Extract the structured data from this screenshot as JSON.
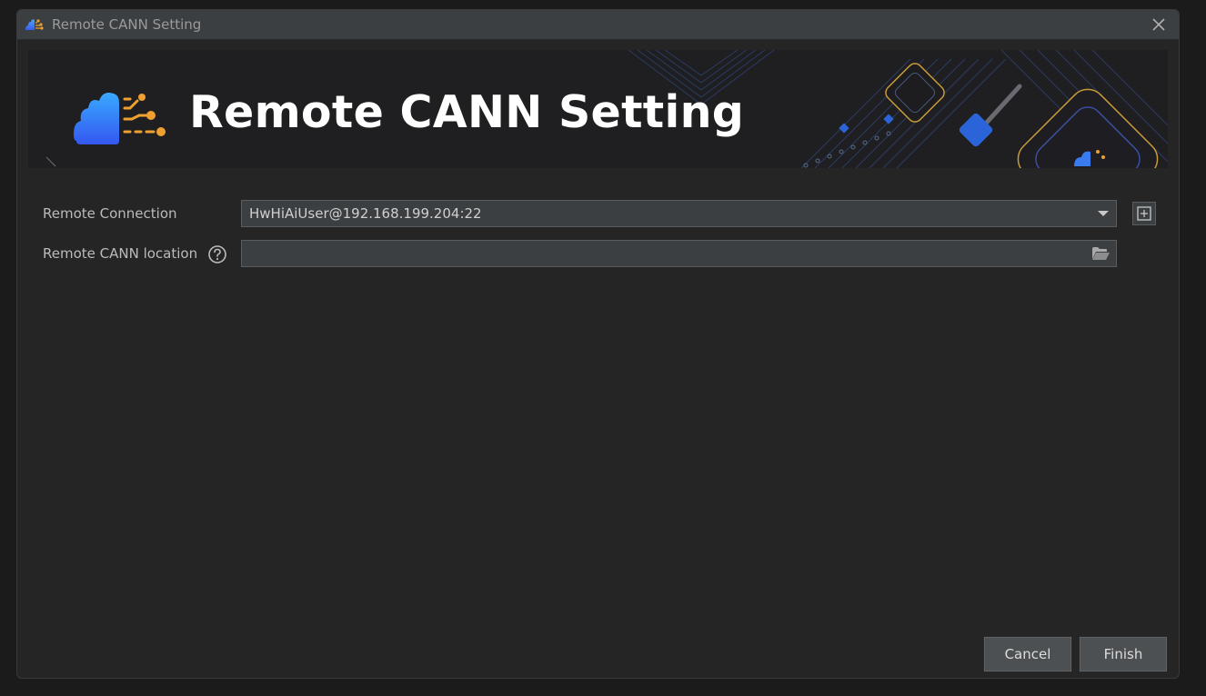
{
  "window": {
    "title": "Remote CANN Setting"
  },
  "banner": {
    "heading": "Remote CANN Setting"
  },
  "form": {
    "connection_label": "Remote Connection",
    "connection_value": "HwHiAiUser@192.168.199.204:22",
    "location_label": "Remote CANN location",
    "location_value": ""
  },
  "buttons": {
    "cancel": "Cancel",
    "finish": "Finish"
  },
  "icons": {
    "app": "cann-cloud-icon",
    "close": "close-icon",
    "help": "help-icon",
    "add": "add-icon",
    "folder": "folder-icon",
    "dropdown": "chevron-down-icon"
  },
  "colors": {
    "accent_blue": "#3d7cf0",
    "accent_orange": "#f0a030"
  }
}
